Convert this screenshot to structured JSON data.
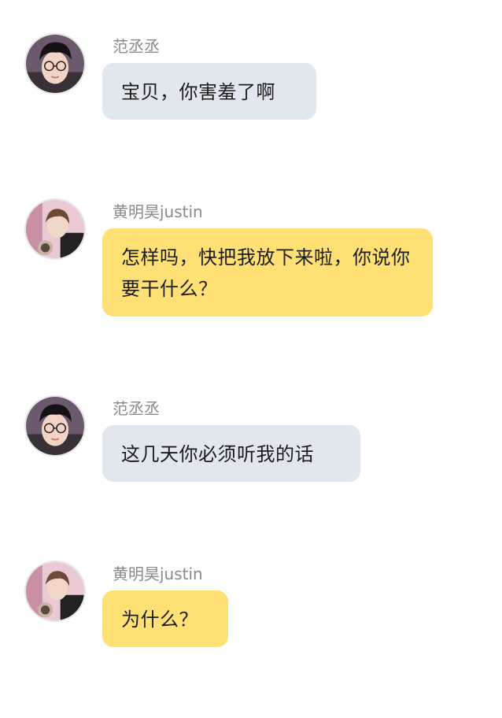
{
  "messages": [
    {
      "sender": "范丞丞",
      "text": "宝贝，你害羞了啊",
      "bubble_color": "#e1e7ee",
      "avatar_icon": "avatar-fan-chengcheng"
    },
    {
      "sender": "黄明昊justin",
      "text": "怎样吗，快把我放下来啦，你说你要干什么？",
      "bubble_color": "#fee075",
      "avatar_icon": "avatar-huang-minghao"
    },
    {
      "sender": "范丞丞",
      "text": "这几天你必须听我的话",
      "bubble_color": "#e1e7ee",
      "avatar_icon": "avatar-fan-chengcheng"
    },
    {
      "sender": "黄明昊justin",
      "text": "为什么？",
      "bubble_color": "#fee075",
      "avatar_icon": "avatar-huang-minghao"
    }
  ]
}
